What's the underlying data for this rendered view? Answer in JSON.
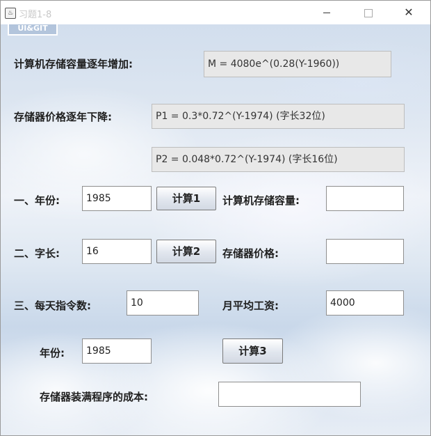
{
  "window": {
    "title": "习题1-8"
  },
  "logo": {
    "text": "UI&GIT"
  },
  "formulas": {
    "capacity_label": "计算机存储容量逐年增加:",
    "capacity_formula": "M = 4080e^(0.28(Y-1960))",
    "price_label": "存储器价格逐年下降:",
    "price_formula_32": "P1 = 0.3*0.72^(Y-1974) (字长32位)",
    "price_formula_16": "P2 = 0.048*0.72^(Y-1974) (字长16位)"
  },
  "part1": {
    "label": "一、年份:",
    "year_value": "1985",
    "button": "计算1",
    "result_label": "计算机存储容量:",
    "result_value": ""
  },
  "part2": {
    "label": "二、字长:",
    "wordlen_value": "16",
    "button": "计算2",
    "result_label": "存储器价格:",
    "result_value": ""
  },
  "part3": {
    "label": "三、每天指令数:",
    "instr_value": "10",
    "salary_label": "月平均工资:",
    "salary_value": "4000",
    "year_label": "年份:",
    "year_value": "1985",
    "button": "计算3",
    "cost_label": "存储器装满程序的成本:",
    "cost_value": ""
  }
}
